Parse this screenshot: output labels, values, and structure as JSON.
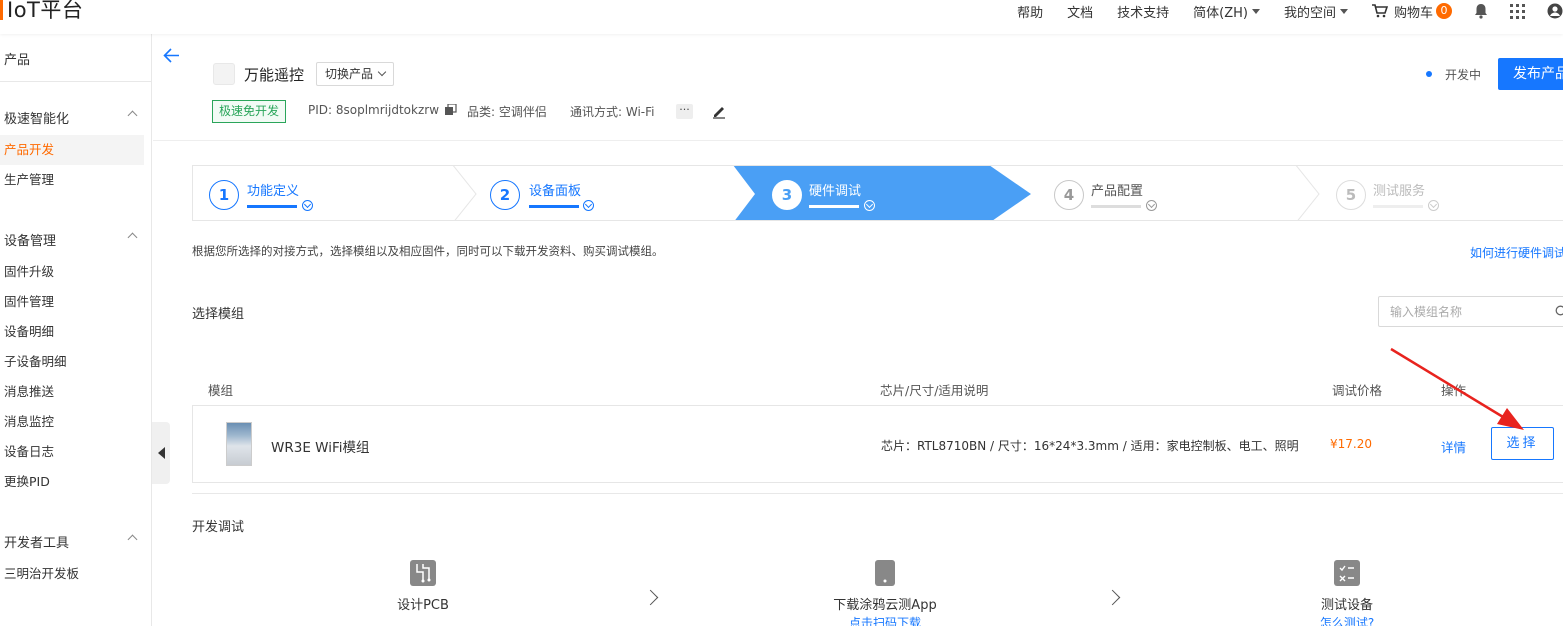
{
  "header": {
    "logo": "IoT平台",
    "nav": [
      {
        "label": "帮助"
      },
      {
        "label": "文档"
      },
      {
        "label": "技术支持"
      },
      {
        "label": "简体(ZH)"
      },
      {
        "label": "我的空间"
      }
    ],
    "cart_label": "购物车",
    "cart_count": "0"
  },
  "sidebar": {
    "title": "产品",
    "groups": [
      {
        "label": "极速智能化",
        "items": [
          "产品开发",
          "生产管理"
        ]
      },
      {
        "label": "设备管理",
        "items": [
          "固件升级",
          "固件管理",
          "设备明细",
          "子设备明细",
          "消息推送",
          "消息监控",
          "设备日志",
          "更换PID"
        ]
      },
      {
        "label": "开发者工具",
        "items": [
          "三明治开发板"
        ]
      }
    ],
    "active_item": "产品开发"
  },
  "product": {
    "name": "万能遥控",
    "switch_label": "切换产品",
    "tag": "极速免开发",
    "pid": "PID: 8soplmrijdtokzrw",
    "category": "品类: 空调伴侣",
    "protocol": "通讯方式: Wi-Fi",
    "more": "···",
    "status": "开发中",
    "publish_label": "发布产品"
  },
  "steps": [
    {
      "num": "1",
      "label": "功能定义",
      "state": "done"
    },
    {
      "num": "2",
      "label": "设备面板",
      "state": "done"
    },
    {
      "num": "3",
      "label": "硬件调试",
      "state": "active"
    },
    {
      "num": "4",
      "label": "产品配置",
      "state": "pending"
    },
    {
      "num": "5",
      "label": "测试服务",
      "state": "disabled"
    }
  ],
  "content": {
    "description": "根据您所选择的对接方式，选择模组以及相应固件，同时可以下载开发资料、购买调试模组。",
    "help_link": "如何进行硬件调试",
    "select_module_title": "选择模组",
    "search_placeholder": "输入模组名称"
  },
  "table": {
    "headers": [
      "模组",
      "芯片/尺寸/适用说明",
      "调试价格",
      "操作"
    ],
    "rows": [
      {
        "module": "WR3E WiFi模组",
        "chip": "芯片：RTL8710BN / 尺寸：16*24*3.3mm / 适用：家电控制板、电工、照明",
        "price": "¥17.20",
        "detail": "详情",
        "select": "选择"
      }
    ]
  },
  "dev": {
    "title": "开发调试",
    "steps": [
      {
        "label": "设计PCB",
        "sub": ""
      },
      {
        "label": "下载涂鸦云测App",
        "sub": "点击扫码下载"
      },
      {
        "label": "测试设备",
        "sub": "怎么测试?"
      }
    ]
  },
  "colors": {
    "brand": "#ff6a00",
    "primary": "#1677ff",
    "active_step": "#4a9ff5",
    "success": "#2aa55a",
    "annotation": "#e8231e"
  }
}
